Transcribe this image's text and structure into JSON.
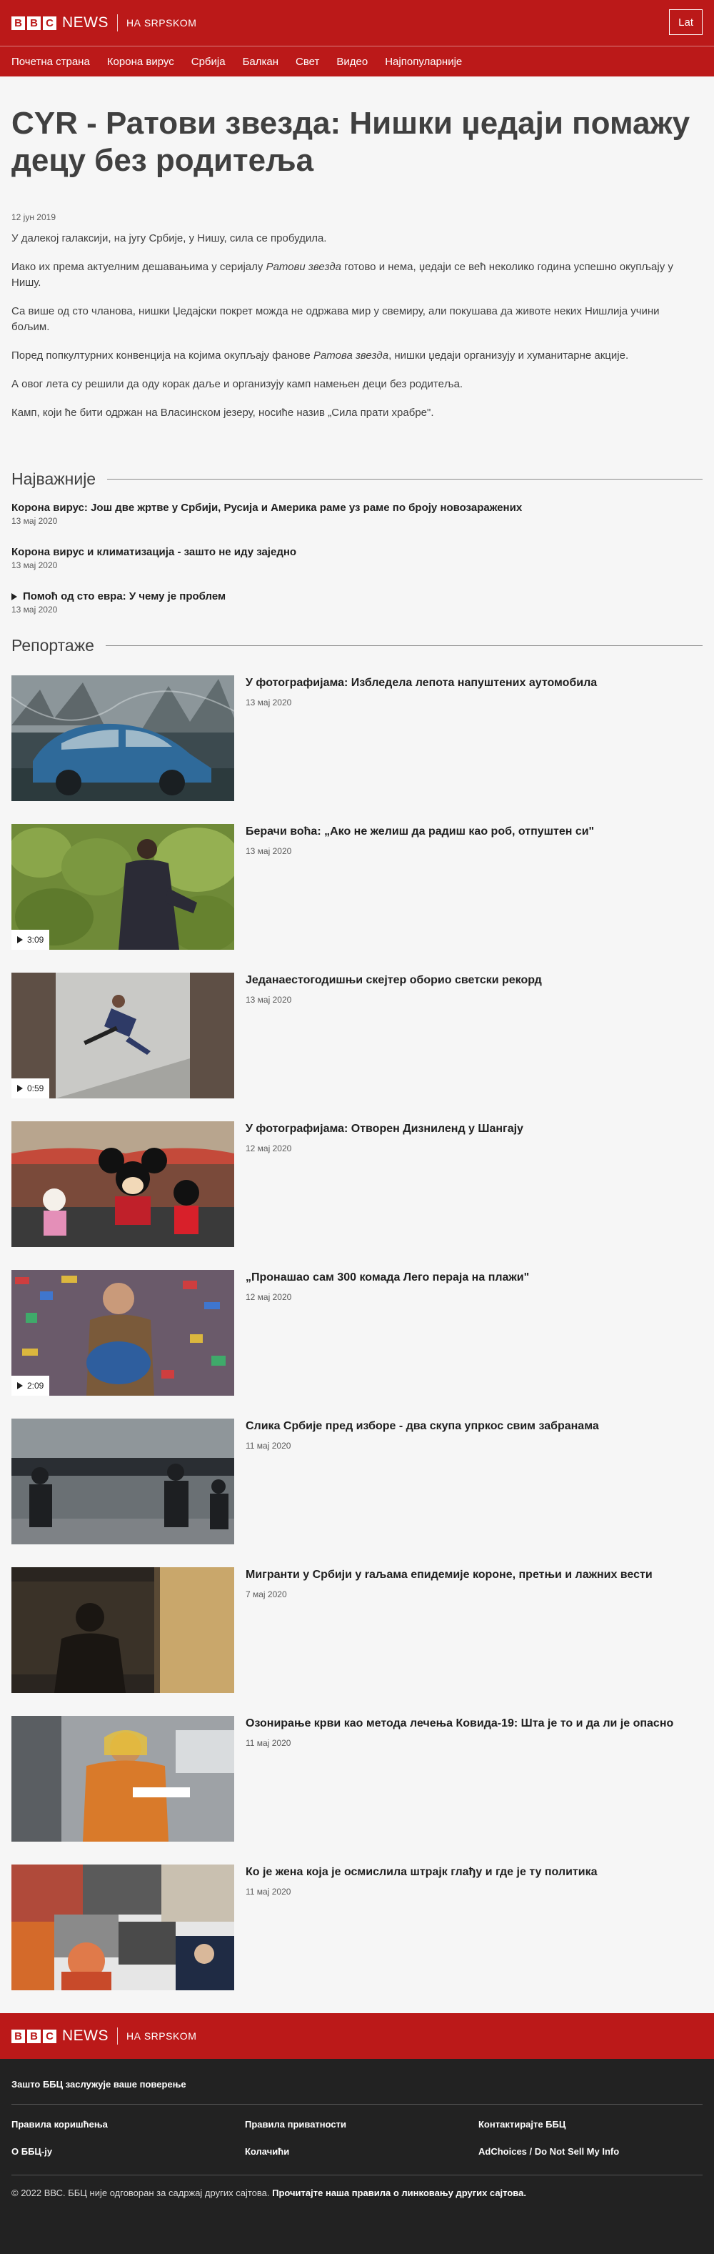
{
  "header": {
    "logo_letters": [
      "B",
      "B",
      "C"
    ],
    "news_word": "NEWS",
    "service_name": "НА SRPSKOM",
    "lang_switch": "Lat",
    "brand_color": "#bb1919"
  },
  "nav": {
    "items": [
      {
        "label": "Почетна страна"
      },
      {
        "label": "Корона вирус"
      },
      {
        "label": "Србија"
      },
      {
        "label": "Балкан"
      },
      {
        "label": "Свет"
      },
      {
        "label": "Видео"
      },
      {
        "label": "Најпопуларније"
      }
    ]
  },
  "article": {
    "headline": "CYR - Ратови звезда: Нишки џедаји помажу децу без родитеља",
    "timestamp": "12 јун 2019",
    "p1": "У далекој галаксији, на југу Србије, у Нишу, сила се пробудила.",
    "p2_before": "Иако их према актуелним дешавањима у серијалу ",
    "p2_em": "Ратови звезда",
    "p2_after": " готово и нема, џедаји се већ неколико година успешно окупљају у Нишу.",
    "p3": "Са више од сто чланова, нишки Џедајски покрет можда не одржава мир у свемиру, али покушава да животе неких Нишлија учини бољим.",
    "p4_before": "Поред попкултурних конвенција на којима окупљају фанове ",
    "p4_em": "Ратова звезда",
    "p4_after": ", нишки џедаји организују и хуманитарне акције.",
    "p5": "А овог лета су решили да оду корак даље и организују камп намењен деци без родитеља.",
    "p6": "Камп, који ће бити одржан на Власинском језеру, носиће назив „Сила прати храбре\"."
  },
  "top_stories": {
    "title": "Најважније",
    "items": [
      {
        "title": "Корона вирус: Још две жртве у Србији, Русија и Америка раме уз раме по броју новозаражених",
        "date": "13 мај 2020",
        "video": false
      },
      {
        "title": "Корона вирус и климатизација - зашто не иду заједно",
        "date": "13 мај 2020",
        "video": false
      },
      {
        "title": "Помоћ од сто евра: У чему је проблем",
        "date": "13 мај 2020",
        "video": true
      }
    ]
  },
  "reportage": {
    "title": "Репортаже",
    "items": [
      {
        "title": "У фотографијама: Избледела лепота напуштених аутомобила",
        "date": "13 мај 2020",
        "duration": null
      },
      {
        "title": "Берачи воћа: „Ако не желиш да радиш као роб, отпуштен си\"",
        "date": "13 мај 2020",
        "duration": "3:09"
      },
      {
        "title": "Једанаестогодишњи скејтер оборио светски рекорд",
        "date": "13 мај 2020",
        "duration": "0:59"
      },
      {
        "title": "У фотографијама: Отворен Дизниленд у Шангају",
        "date": "12 мај 2020",
        "duration": null
      },
      {
        "title": "„Пронашао сам 300 комада Лего пераја на плажи\"",
        "date": "12 мај 2020",
        "duration": "2:09"
      },
      {
        "title": "Слика Србије пред изборе - два скупа упркос свим забранама",
        "date": "11 мај 2020",
        "duration": null
      },
      {
        "title": "Мигранти у Србији у raљама епидемије короне, претњи и лажних вести",
        "date": "7 мај 2020",
        "duration": null
      },
      {
        "title": "Озонирање крви као метода лечења Ковида-19: Шта је то и да ли је опасно",
        "date": "11 мај 2020",
        "duration": null
      },
      {
        "title": "Ко је жена која је осмислила штрајк глађу и где је ту политика",
        "date": "11 мај 2020",
        "duration": null
      }
    ]
  },
  "footer": {
    "trust_link": "Зашто ББЦ заслужује ваше поверење",
    "links": [
      "Правила коришћења",
      "Правила приватности",
      "Контактирајте ББЦ",
      "О ББЦ-ју",
      "Колачићи",
      "AdChoices / Do Not Sell My Info"
    ],
    "copyright_plain": "© 2022 ВВС. ББЦ није одговоран за садржај других сајтова.",
    "copyright_bold": "Прочитајте наша правила о линковању других сајтова."
  }
}
